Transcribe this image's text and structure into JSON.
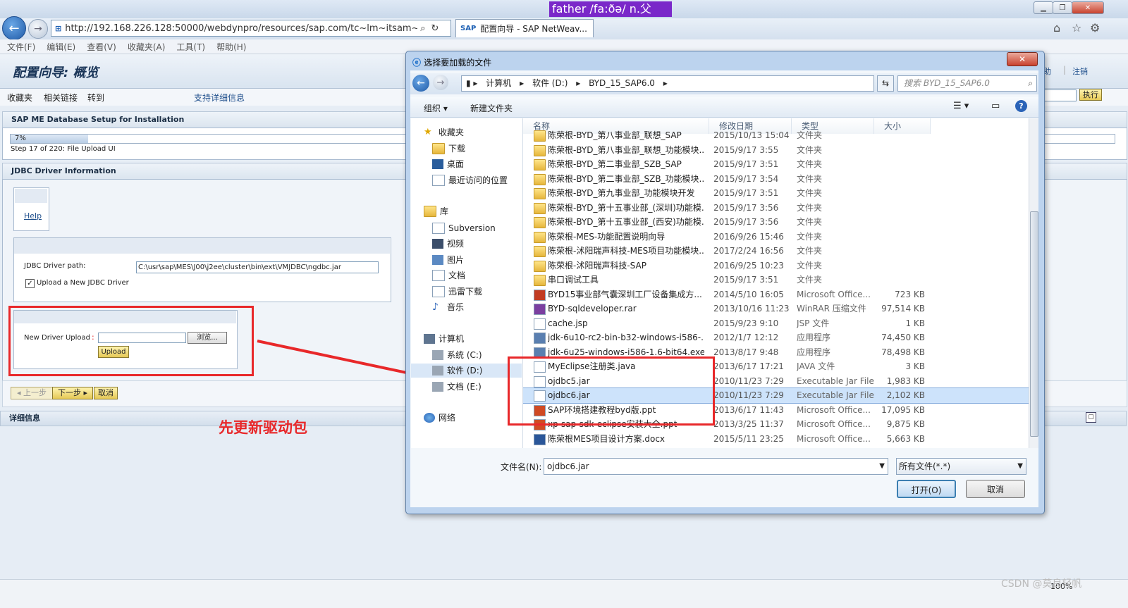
{
  "browser": {
    "url": "http://192.168.226.128:50000/webdynpro/resources/sap.com/tc~lm~itsam~ui~m",
    "tab_title": "配置向导 - SAP NetWeav...",
    "menu": [
      "文件(F)",
      "编辑(E)",
      "查看(V)",
      "收藏夹(A)",
      "工具(T)",
      "帮助(H)"
    ],
    "zoom": "100%",
    "dict_popup": "father /fa:ðə/  n.父"
  },
  "sap": {
    "page_title": "配置向导: 概览",
    "toolbar": [
      "收藏夹",
      "相关链接",
      "转到",
      "支持详细信息"
    ],
    "header_links": [
      "助",
      "注销"
    ],
    "execute_btn": "执行",
    "setup_title": "SAP ME Database Setup for Installation",
    "progress_label": "7%",
    "progress_value": 0.07,
    "step_text": "Step 17 of 220: File Upload UI",
    "jdbc_section": "JDBC Driver Information",
    "help_link": "Help",
    "jdbc_path_label": "JDBC Driver path:",
    "jdbc_path_value": "C:\\usr\\sap\\MES\\J00\\j2ee\\cluster\\bin\\ext\\VMJDBC\\ngdbc.jar",
    "upload_new_label": "Upload a New JDBC Driver",
    "new_driver_label": "New Driver Upload",
    "browse_btn": "浏览...",
    "upload_btn": "Upload",
    "prev_btn": "上一步",
    "next_btn": "下一步",
    "cancel_btn": "取消",
    "details": "详细信息"
  },
  "annotation": "先更新驱动包",
  "watermark": "CSDN @莫良轻帆",
  "dialog": {
    "title": "选择要加载的文件",
    "breadcrumb": [
      "计算机",
      "软件 (D:)",
      "BYD_15_SAP6.0"
    ],
    "search_placeholder": "搜索 BYD_15_SAP6.0",
    "organize": "组织",
    "new_folder": "新建文件夹",
    "columns": [
      "名称",
      "修改日期",
      "类型",
      "大小"
    ],
    "nav": {
      "favorites": "收藏夹",
      "fav_items": [
        "下载",
        "桌面",
        "最近访问的位置"
      ],
      "library": "库",
      "lib_items": [
        "Subversion",
        "视频",
        "图片",
        "文档",
        "迅雷下载",
        "音乐"
      ],
      "computer": "计算机",
      "comp_items": [
        "系统 (C:)",
        "软件 (D:)",
        "文档 (E:)"
      ],
      "network": "网络"
    },
    "files": [
      {
        "name": "陈荣根-BYD_第八事业部_联想_SAP",
        "date": "2015/10/13 15:04",
        "type": "文件夹",
        "size": "",
        "kind": "folder"
      },
      {
        "name": "陈荣根-BYD_第八事业部_联想_功能模块...",
        "date": "2015/9/17 3:55",
        "type": "文件夹",
        "size": "",
        "kind": "folder"
      },
      {
        "name": "陈荣根-BYD_第二事业部_SZB_SAP",
        "date": "2015/9/17 3:51",
        "type": "文件夹",
        "size": "",
        "kind": "folder"
      },
      {
        "name": "陈荣根-BYD_第二事业部_SZB_功能模块...",
        "date": "2015/9/17 3:54",
        "type": "文件夹",
        "size": "",
        "kind": "folder"
      },
      {
        "name": "陈荣根-BYD_第九事业部_功能模块开发",
        "date": "2015/9/17 3:51",
        "type": "文件夹",
        "size": "",
        "kind": "folder"
      },
      {
        "name": "陈荣根-BYD_第十五事业部_(深圳)功能模...",
        "date": "2015/9/17 3:56",
        "type": "文件夹",
        "size": "",
        "kind": "folder"
      },
      {
        "name": "陈荣根-BYD_第十五事业部_(西安)功能模...",
        "date": "2015/9/17 3:56",
        "type": "文件夹",
        "size": "",
        "kind": "folder"
      },
      {
        "name": "陈荣根-MES-功能配置说明向导",
        "date": "2016/9/26 15:46",
        "type": "文件夹",
        "size": "",
        "kind": "folder"
      },
      {
        "name": "陈荣根-沭阳瑞声科技-MES项目功能模块...",
        "date": "2017/2/24 16:56",
        "type": "文件夹",
        "size": "",
        "kind": "folder"
      },
      {
        "name": "陈荣根-沭阳瑞声科技-SAP",
        "date": "2016/9/25 10:23",
        "type": "文件夹",
        "size": "",
        "kind": "folder"
      },
      {
        "name": "串口调试工具",
        "date": "2015/9/17 3:51",
        "type": "文件夹",
        "size": "",
        "kind": "folder"
      },
      {
        "name": "BYD15事业部气囊深圳工厂设备集成方...",
        "date": "2014/5/10 16:05",
        "type": "Microsoft Office...",
        "size": "723 KB",
        "kind": "office"
      },
      {
        "name": "BYD-sqldeveloper.rar",
        "date": "2013/10/16 11:23",
        "type": "WinRAR 压缩文件",
        "size": "97,514 KB",
        "kind": "rar"
      },
      {
        "name": "cache.jsp",
        "date": "2015/9/23 9:10",
        "type": "JSP 文件",
        "size": "1 KB",
        "kind": "file"
      },
      {
        "name": "jdk-6u10-rc2-bin-b32-windows-i586-...",
        "date": "2012/1/7 12:12",
        "type": "应用程序",
        "size": "74,450 KB",
        "kind": "exe"
      },
      {
        "name": "jdk-6u25-windows-i586-1.6-bit64.exe",
        "date": "2013/8/17 9:48",
        "type": "应用程序",
        "size": "78,498 KB",
        "kind": "exe"
      },
      {
        "name": "MyEclipse注册类.java",
        "date": "2013/6/17 17:21",
        "type": "JAVA 文件",
        "size": "3 KB",
        "kind": "file"
      },
      {
        "name": "ojdbc5.jar",
        "date": "2010/11/23 7:29",
        "type": "Executable Jar File",
        "size": "1,983 KB",
        "kind": "jar"
      },
      {
        "name": "ojdbc6.jar",
        "date": "2010/11/23 7:29",
        "type": "Executable Jar File",
        "size": "2,102 KB",
        "kind": "jar",
        "selected": true
      },
      {
        "name": "SAP环境搭建教程byd版.ppt",
        "date": "2013/6/17 11:43",
        "type": "Microsoft Office...",
        "size": "17,095 KB",
        "kind": "ppt"
      },
      {
        "name": "xp-sap-sdk-eclipse安装大全.ppt",
        "date": "2013/3/25 11:37",
        "type": "Microsoft Office...",
        "size": "9,875 KB",
        "kind": "ppt"
      },
      {
        "name": "陈荣根MES项目设计方案.docx",
        "date": "2015/5/11 23:25",
        "type": "Microsoft Office...",
        "size": "5,663 KB",
        "kind": "doc"
      }
    ],
    "filename_label": "文件名(N):",
    "filename_value": "ojdbc6.jar",
    "filetype_value": "所有文件(*.*)",
    "open_btn": "打开(O)",
    "cancel_btn": "取消"
  },
  "colors": {
    "accent_red": "#e8282a",
    "selection": "#cde3fb"
  }
}
